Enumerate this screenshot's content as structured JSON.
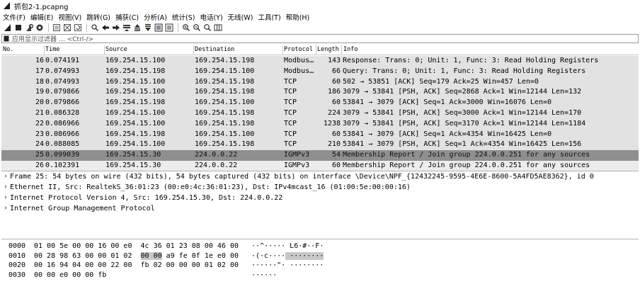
{
  "window": {
    "title": "抓包2-1.pcapng"
  },
  "menubar": {
    "items": [
      "文件(F)",
      "编辑(E)",
      "视图(V)",
      "跳转(G)",
      "捕获(C)",
      "分析(A)",
      "统计(S)",
      "电话(Y)",
      "无线(W)",
      "工具(T)",
      "帮助(H)"
    ]
  },
  "toolbar": {
    "icons": [
      "shark-fin-start-icon",
      "stop-icon",
      "restart-icon",
      "options-gear-icon",
      "open-file-icon",
      "file-icon",
      "close-file-icon",
      "reload-icon",
      "find-icon",
      "back-arrow-icon",
      "forward-arrow-icon",
      "goto-packet-icon",
      "first-packet-icon",
      "last-packet-icon",
      "autoscroll-icon",
      "colorize-icon",
      "zoom-in-icon",
      "zoom-out-icon",
      "zoom-normal-icon",
      "resize-columns-icon"
    ]
  },
  "filter": {
    "placeholder": "应用显示过滤器 … <Ctrl-/>"
  },
  "columns": {
    "no": "No.",
    "time": "Time",
    "source": "Source",
    "destination": "Destination",
    "protocol": "Protocol",
    "length": "Length",
    "info": "Info"
  },
  "packets": [
    {
      "no": "16",
      "time": "0.074191",
      "src": "169.254.15.100",
      "dst": "169.254.15.198",
      "proto": "Modbus…",
      "len": "143",
      "info": "Response: Trans:     0; Unit:   1, Func:   3: Read Holding Registers"
    },
    {
      "no": "17",
      "time": "0.074993",
      "src": "169.254.15.198",
      "dst": "169.254.15.100",
      "proto": "Modbus…",
      "len": "66",
      "info": "   Query: Trans:     0; Unit:   1, Func:   3: Read Holding Registers"
    },
    {
      "no": "18",
      "time": "0.074993",
      "src": "169.254.15.100",
      "dst": "169.254.15.198",
      "proto": "TCP",
      "len": "60",
      "info": "502 → 53851 [ACK] Seq=179 Ack=25 Win=457 Len=0"
    },
    {
      "no": "19",
      "time": "0.079866",
      "src": "169.254.15.100",
      "dst": "169.254.15.198",
      "proto": "TCP",
      "len": "186",
      "info": "3079 → 53841 [PSH, ACK] Seq=2868 Ack=1 Win=12144 Len=132"
    },
    {
      "no": "20",
      "time": "0.079866",
      "src": "169.254.15.198",
      "dst": "169.254.15.100",
      "proto": "TCP",
      "len": "60",
      "info": "53841 → 3079 [ACK] Seq=1 Ack=3000 Win=16076 Len=0"
    },
    {
      "no": "21",
      "time": "0.086328",
      "src": "169.254.15.100",
      "dst": "169.254.15.198",
      "proto": "TCP",
      "len": "224",
      "info": "3079 → 53841 [PSH, ACK] Seq=3000 Ack=1 Win=12144 Len=170"
    },
    {
      "no": "22",
      "time": "0.086966",
      "src": "169.254.15.100",
      "dst": "169.254.15.198",
      "proto": "TCP",
      "len": "1238",
      "info": "3079 → 53841 [PSH, ACK] Seq=3170 Ack=1 Win=12144 Len=1184"
    },
    {
      "no": "23",
      "time": "0.086966",
      "src": "169.254.15.198",
      "dst": "169.254.15.100",
      "proto": "TCP",
      "len": "60",
      "info": "53841 → 3079 [ACK] Seq=1 Ack=4354 Win=16425 Len=0"
    },
    {
      "no": "24",
      "time": "0.088085",
      "src": "169.254.15.100",
      "dst": "169.254.15.198",
      "proto": "TCP",
      "len": "210",
      "info": "53841 → 3079 [PSH, ACK] Seq=1 Ack=4354 Win=16425 Len=156"
    },
    {
      "no": "25",
      "time": "0.099039",
      "src": "169.254.15.30",
      "dst": "224.0.0.22",
      "proto": "IGMPv3",
      "len": "54",
      "info": "Membership Report / Join group 224.0.0.251 for any sources"
    },
    {
      "no": "26",
      "time": "0.102391",
      "src": "169.254.15.30",
      "dst": "224.0.0.22",
      "proto": "IGMPv3",
      "len": "60",
      "info": "Membership Report / Join group 224.0.0.251 for any sources"
    }
  ],
  "selected_packet_no": "25",
  "details": [
    "Frame 25: 54 bytes on wire (432 bits), 54 bytes captured (432 bits) on interface \\Device\\NPF_{12432245-9595-4E6E-8600-5A4FD5AE8362}, id 0",
    "Ethernet II, Src: RealtekS_36:01:23 (00:e0:4c:36:01:23), Dst: IPv4mcast_16 (01:00:5e:00:00:16)",
    "Internet Protocol Version 4, Src: 169.254.15.30, Dst: 224.0.0.22",
    "Internet Group Management Protocol"
  ],
  "hex": [
    {
      "offset": "0000",
      "bytes_a": "01 00 5e 00 00 16 00 e0  4c 36 01 23 08 00 46 00",
      "ascii_a": "··^····· L6·#··F·",
      "hl_bytes": "",
      "bytes_b": "",
      "ascii_hl": "",
      "ascii_b": ""
    },
    {
      "offset": "0010",
      "bytes_a": "00 28 98 63 00 00 01 02  ",
      "hl_bytes": "00 00",
      "bytes_b": " a9 fe 0f 1e e0 00",
      "ascii_a": "·(·c····",
      "ascii_hl": " ········",
      "ascii_b": ""
    },
    {
      "offset": "0020",
      "bytes_a": "00 16 94 04 00 00 22 00  fb 02 00 00 00 01 02 00",
      "ascii_a": "······\"· ········",
      "hl_bytes": "",
      "bytes_b": "",
      "ascii_hl": "",
      "ascii_b": ""
    },
    {
      "offset": "0030",
      "bytes_a": "00 00 e0 00 00 fb",
      "ascii_a": "······",
      "hl_bytes": "",
      "bytes_b": "",
      "ascii_hl": "",
      "ascii_b": ""
    }
  ]
}
